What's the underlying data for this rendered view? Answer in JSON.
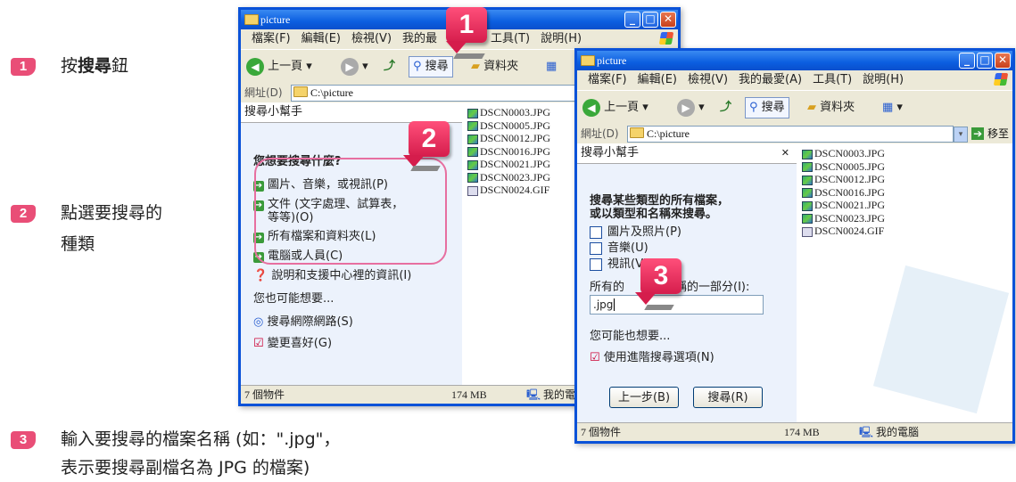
{
  "steps": [
    {
      "num": "1",
      "text_pre": "按",
      "text_bold": "搜尋",
      "text_post": "鈕"
    },
    {
      "num": "2",
      "line1": "點選要搜尋的",
      "line2": "種類"
    },
    {
      "num": "3",
      "line1": "輸入要搜尋的檔案名稱 (如：\".jpg\"，",
      "line2": "表示要搜尋副檔名為 JPG 的檔案)"
    }
  ],
  "back_window": {
    "title": "picture",
    "menu": [
      "檔案(F)",
      "編輯(E)",
      "檢視(V)",
      "我的最",
      "工具(T)",
      "說明(H)"
    ],
    "toolbar": {
      "back": "上一頁",
      "search": "搜尋",
      "folders": "資料夾"
    },
    "address_label": "網址(D)",
    "address_value": "C:\\picture",
    "pane_title": "搜尋小幫手",
    "question": "您想要搜尋什麼?",
    "options": [
      "圖片、音樂，或視訊(P)",
      "文件 (文字處理、試算表，",
      "等等)(O)",
      "所有檔案和資料夾(L)",
      "電腦或人員(C)"
    ],
    "help_link": "說明和支援中心裡的資訊(I)",
    "also": "您也可能想要...",
    "extra_links": [
      "搜尋網際網路(S)",
      "變更喜好(G)"
    ],
    "status": {
      "objects": "7 個物件",
      "size": "174 MB",
      "location": "我的電"
    }
  },
  "front_window": {
    "title": "picture",
    "menu": [
      "檔案(F)",
      "編輯(E)",
      "檢視(V)",
      "我的最愛(A)",
      "工具(T)",
      "說明(H)"
    ],
    "toolbar": {
      "back": "上一頁",
      "search": "搜尋",
      "folders": "資料夾"
    },
    "address_label": "網址(D)",
    "address_value": "C:\\picture",
    "go": "移至",
    "pane_title": "搜尋小幫手",
    "instruction1": "搜尋某些類型的所有檔案，",
    "instruction2": "或以類型和名稱來搜尋。",
    "checks": [
      "圖片及照片(P)",
      "音樂(U)",
      "視訊(V)"
    ],
    "name_label_pre": "所有的",
    "name_label_post": "名稱的一部分(I):",
    "name_value": ".jpg",
    "also": "您可能也想要...",
    "advanced": "使用進階搜尋選項(N)",
    "btn_back": "上一步(B)",
    "btn_search": "搜尋(R)",
    "status": {
      "objects": "7 個物件",
      "size": "174 MB",
      "location": "我的電腦"
    }
  },
  "files": [
    "DSCN0003.JPG",
    "DSCN0005.JPG",
    "DSCN0012.JPG",
    "DSCN0016.JPG",
    "DSCN0021.JPG",
    "DSCN0023.JPG",
    "DSCN0024.GIF"
  ],
  "callouts": [
    "1",
    "2",
    "3"
  ],
  "colors": {
    "accent": "#e94e77",
    "xp_blue": "#0a52d8",
    "pane_bg": "#ecf2fc"
  }
}
